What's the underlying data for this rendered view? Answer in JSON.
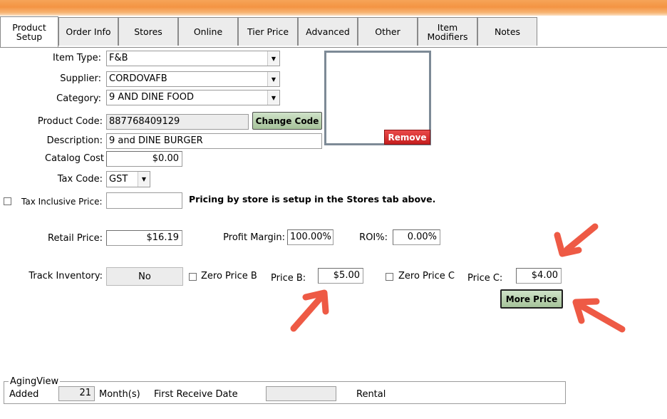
{
  "tabs": [
    "Product Setup",
    "Order Info",
    "Stores",
    "Online",
    "Tier Price",
    "Advanced",
    "Other",
    "Item\nModifiers",
    "Notes"
  ],
  "form": {
    "item_type_label": "Item Type:",
    "item_type_value": "F&B",
    "supplier_label": "Supplier:",
    "supplier_value": "CORDOVAFB",
    "category_label": "Category:",
    "category_value": "9 AND DINE FOOD",
    "product_code_label": "Product Code:",
    "product_code_value": "887768409129",
    "change_code_label": "Change Code",
    "description_label": "Description:",
    "description_value": "9 and DINE BURGER",
    "catalog_cost_label": "Catalog Cost",
    "catalog_cost_value": "$0.00",
    "tax_code_label": "Tax Code:",
    "tax_code_value": "GST",
    "tax_inclusive_label": "Tax Inclusive Price:",
    "tax_inclusive_value": "",
    "pricing_note": "Pricing by store is setup in the Stores tab above.",
    "retail_price_label": "Retail Price:",
    "retail_price_value": "$16.19",
    "profit_margin_label": "Profit Margin:",
    "profit_margin_value": "100.00%",
    "roi_label": "ROI%:",
    "roi_value": "0.00%",
    "track_inventory_label": "Track Inventory:",
    "track_inventory_value": "No",
    "zero_price_b_label": "Zero Price B",
    "price_b_label": "Price B:",
    "price_b_value": "$5.00",
    "zero_price_c_label": "Zero Price C",
    "price_c_label": "Price C:",
    "price_c_value": "$4.00",
    "more_price_label": "More Price",
    "remove_label": "Remove"
  },
  "aging": {
    "legend": "AgingView",
    "added_label": "Added",
    "months_value": "21",
    "months_label": "Month(s)",
    "first_receive_label": "First Receive Date",
    "first_receive_value": "",
    "rental_label": "Rental"
  },
  "colors": {
    "arrow": "#ee5a45",
    "titlebar": "#f49443",
    "button_green": "#a6c39a",
    "button_red": "#d42a2a"
  }
}
